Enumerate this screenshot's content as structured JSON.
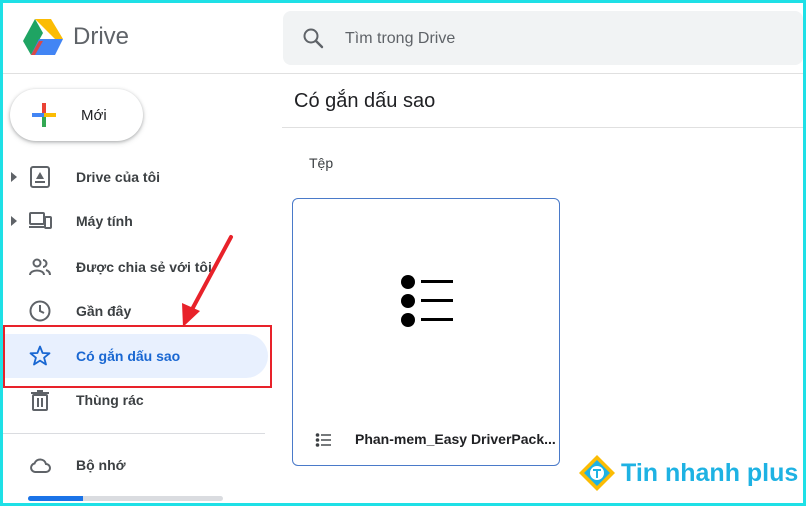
{
  "app": {
    "name": "Drive"
  },
  "search": {
    "placeholder": "Tìm trong Drive"
  },
  "new_button": {
    "label": "Mới"
  },
  "sidebar": {
    "items": [
      {
        "label": "Drive của tôi",
        "icon": "my-drive-icon",
        "expandable": true,
        "active": false
      },
      {
        "label": "Máy tính",
        "icon": "computer-icon",
        "expandable": true,
        "active": false
      },
      {
        "label": "Được chia sẻ với tôi",
        "icon": "shared-icon",
        "expandable": false,
        "active": false
      },
      {
        "label": "Gần đây",
        "icon": "recent-clock-icon",
        "expandable": false,
        "active": false
      },
      {
        "label": "Có gắn dấu sao",
        "icon": "star-icon",
        "expandable": false,
        "active": true
      },
      {
        "label": "Thùng rác",
        "icon": "trash-icon",
        "expandable": false,
        "active": false
      }
    ],
    "storage": {
      "label": "Bộ nhớ",
      "icon": "cloud-icon",
      "used_fraction": 0.28
    }
  },
  "main": {
    "title": "Có gắn dấu sao",
    "section_label": "Tệp",
    "files": [
      {
        "name": "Phan-mem_Easy DriverPack...",
        "icon": "list-file-icon"
      }
    ]
  },
  "watermark": {
    "text": "Tin nhanh plus"
  },
  "colors": {
    "accent": "#1a73e8",
    "active_bg": "#e8f0fe",
    "highlight": "#e8222a",
    "border": "#1ee0e6"
  }
}
